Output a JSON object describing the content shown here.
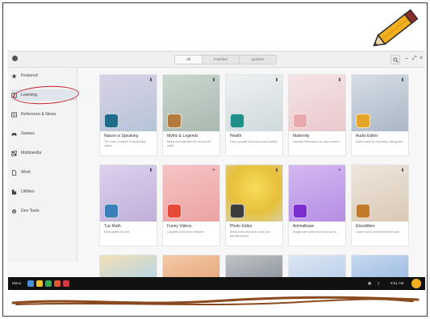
{
  "window": {
    "view_switcher": [
      "All",
      "Installed",
      "Updates"
    ],
    "active_view": "All"
  },
  "sidebar": {
    "items": [
      {
        "label": "Featured",
        "icon": "star-icon"
      },
      {
        "label": "Learning",
        "icon": "book-icon"
      },
      {
        "label": "Reference & News",
        "icon": "news-icon"
      },
      {
        "label": "Games",
        "icon": "gamepad-icon"
      },
      {
        "label": "Multimedia",
        "icon": "multimedia-icon"
      },
      {
        "label": "Work",
        "icon": "document-icon"
      },
      {
        "label": "Utilities",
        "icon": "utilities-icon"
      },
      {
        "label": "Dev Tools",
        "icon": "devtools-icon"
      }
    ],
    "selected": "Learning"
  },
  "cards": [
    {
      "name": "Nature is Speaking",
      "desc": "The voice of nature in storytelling videos",
      "mark": "⬇"
    },
    {
      "name": "Myths & Legends",
      "desc": "Myths and legends from around the world",
      "mark": "⬇"
    },
    {
      "name": "Health",
      "desc": "Keep yourself and loved ones healthy",
      "mark": "⬇"
    },
    {
      "name": "Maternity",
      "desc": "Valuable information for new mothers",
      "mark": "⬇"
    },
    {
      "name": "Audio Editor",
      "desc": "Audio editor for recording, slicing and ...",
      "mark": "⬇"
    },
    {
      "name": "Tux Math",
      "desc": "Math games for kids",
      "mark": "⬇"
    },
    {
      "name": "Funny Videos",
      "desc": "Laughter is the best medicine",
      "mark": "+"
    },
    {
      "name": "Photo Editor",
      "desc": "Break rules and shots at all your favorite photos",
      "mark": "⬇"
    },
    {
      "name": "Animalbase",
      "desc": "Images are worth more than words",
      "mark": "+"
    },
    {
      "name": "Ebooklibre",
      "desc": "Learn how to provide the best care",
      "mark": "⬇"
    }
  ],
  "taskbar": {
    "activities": "Menu",
    "time": "9:51 AM",
    "status_icons": [
      "network-icon",
      "battery-icon"
    ]
  },
  "colors": {
    "annotation_red": "#c8242c",
    "scribble_brown": "#8a4a1e",
    "pencil_yellow": "#f2b01e",
    "taskbar_bg": "#111111"
  }
}
